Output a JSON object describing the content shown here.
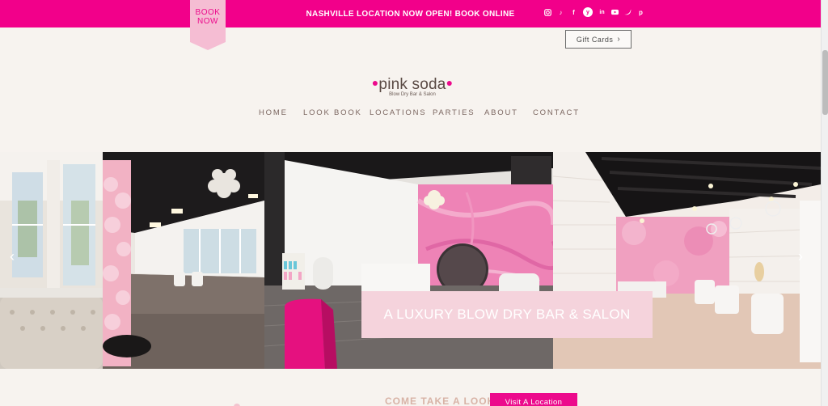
{
  "topbar": {
    "book_label_line1": "BOOK",
    "book_label_line2": "NOW",
    "announcement": "NASHVILLE LOCATION NOW OPEN! BOOK ONLINE",
    "social_icons": [
      "instagram-icon",
      "tiktok-icon",
      "facebook-icon",
      "yelp-icon",
      "linkedin-icon",
      "youtube-icon",
      "twitter-icon",
      "pinterest-icon"
    ],
    "accent": "#f2008a"
  },
  "header": {
    "gift_cards_label": "Gift Cards",
    "logo_name": "pink soda",
    "logo_tagline": "Blow Dry Bar & Salon"
  },
  "nav": {
    "items": [
      "HOME",
      "LOOK BOOK",
      "LOCATIONS",
      "PARTIES",
      "ABOUT",
      "CONTACT"
    ]
  },
  "hero": {
    "caption": "A LUXURY BLOW DRY BAR & SALON"
  },
  "bottom": {
    "title": "COME TAKE A LOOK",
    "visit_label": "Visit A Location"
  }
}
